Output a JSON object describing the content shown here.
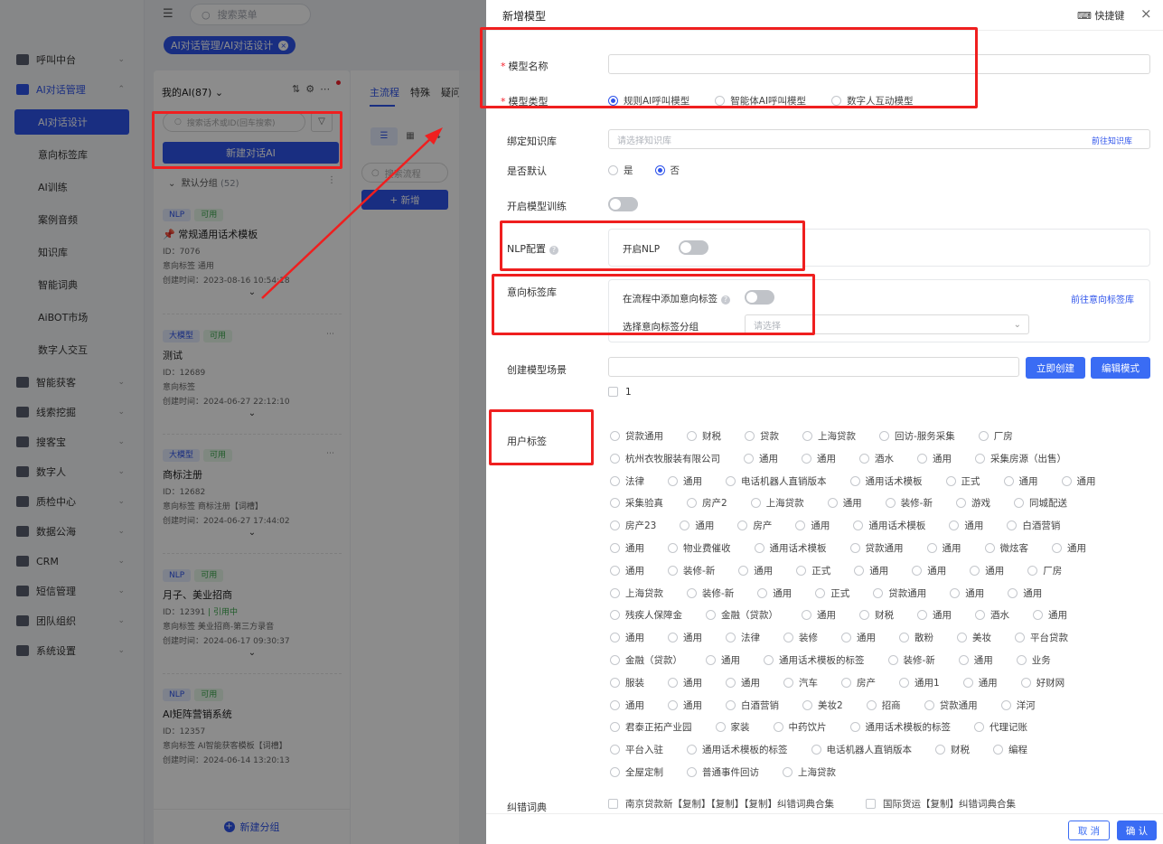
{
  "topbar": {
    "search_placeholder": "搜索菜单"
  },
  "breadcrumb": {
    "tag": "AI对话管理/AI对话设计"
  },
  "sidenav": {
    "items": [
      {
        "label": "呼叫中台"
      },
      {
        "label": "AI对话管理"
      },
      {
        "label": "智能获客"
      },
      {
        "label": "线索挖掘"
      },
      {
        "label": "搜客宝"
      },
      {
        "label": "数字人"
      },
      {
        "label": "质检中心"
      },
      {
        "label": "数据公海"
      },
      {
        "label": "CRM"
      },
      {
        "label": "短信管理"
      },
      {
        "label": "团队组织"
      },
      {
        "label": "系统设置"
      }
    ],
    "subitems": [
      {
        "label": "AI对话设计"
      },
      {
        "label": "意向标签库"
      },
      {
        "label": "AI训练"
      },
      {
        "label": "案例音频"
      },
      {
        "label": "知识库"
      },
      {
        "label": "智能词典"
      },
      {
        "label": "AiBOT市场"
      },
      {
        "label": "数字人交互"
      }
    ]
  },
  "list": {
    "header": "我的AI(87)",
    "search_placeholder": "搜索话术或ID(回车搜索)",
    "new_button": "新建对话AI",
    "group_label": "默认分组",
    "group_count": "(52)",
    "new_group": "新建分组",
    "cards": [
      {
        "tag1": "NLP",
        "tag2": "可用",
        "title": "常规通用话术模板",
        "id": "ID：7076",
        "intent": "意向标签    通用",
        "created": "创建时间：2023-08-16 10:54:18"
      },
      {
        "tag1": "大模型",
        "tag2": "可用",
        "title": "测试",
        "id": "ID：12689",
        "intent": "意向标签",
        "created": "创建时间：2024-06-27 22:12:10"
      },
      {
        "tag1": "大模型",
        "tag2": "可用",
        "title": "商标注册",
        "id": "ID：12682",
        "intent": "意向标签    商标注册【词槽】",
        "created": "创建时间：2024-06-27 17:44:02"
      },
      {
        "tag1": "NLP",
        "tag2": "可用",
        "title": "月子、美业招商",
        "id": "ID：12391",
        "ref": "引用中",
        "intent": "意向标签    美业招商-第三方录音",
        "created": "创建时间：2024-06-17 09:30:37"
      },
      {
        "tag1": "NLP",
        "tag2": "可用",
        "title": "AI矩阵营销系统",
        "id": "ID：12357",
        "intent": "意向标签    AI智能获客模板【词槽】",
        "created": "创建时间：2024-06-14 13:20:13"
      }
    ]
  },
  "middle": {
    "tabs": [
      "主流程",
      "特殊",
      "疑问"
    ],
    "search_placeholder": "搜索流程",
    "add_button": "+ 新增"
  },
  "drawer": {
    "title": "新增模型",
    "shortcut": "快捷键",
    "model_name_label": "模型名称",
    "model_type_label": "模型类型",
    "model_types": [
      "规则AI呼叫模型",
      "智能体AI呼叫模型",
      "数字人互动模型"
    ],
    "kb_label": "绑定知识库",
    "kb_placeholder": "请选择知识库",
    "kb_link": "前往知识库",
    "default_label": "是否默认",
    "default_options": [
      "是",
      "否"
    ],
    "train_label": "开启模型训练",
    "nlp_label": "NLP配置",
    "nlp_switch_label": "开启NLP",
    "intent_label": "意向标签库",
    "intent_add_label": "在流程中添加意向标签",
    "intent_link": "前往意向标签库",
    "intent_group_label": "选择意向标签分组",
    "intent_group_placeholder": "请选择",
    "scene_label": "创建模型场景",
    "create_now": "立即创建",
    "edit_mode": "编辑模式",
    "scene_option": "1",
    "user_tag_label": "用户标签",
    "user_tags": [
      [
        "贷款通用",
        "财税",
        "贷款",
        "上海贷款",
        "回访-服务采集",
        "厂房"
      ],
      [
        "杭州衣牧服装有限公司",
        "通用",
        "通用",
        "酒水",
        "通用",
        "采集房源（出售）"
      ],
      [
        "法律",
        "通用",
        "电话机器人直销版本",
        "通用话术模板",
        "正式",
        "通用",
        "通用"
      ],
      [
        "采集验真",
        "房产2",
        "上海贷款",
        "通用",
        "装修-新",
        "游戏",
        "同城配送"
      ],
      [
        "房产23",
        "通用",
        "房产",
        "通用",
        "通用话术模板",
        "通用",
        "白酒营销"
      ],
      [
        "通用",
        "物业费催收",
        "通用话术模板",
        "贷款通用",
        "通用",
        "微炫客",
        "通用"
      ],
      [
        "通用",
        "装修-新",
        "通用",
        "正式",
        "通用",
        "通用",
        "通用",
        "厂房"
      ],
      [
        "上海贷款",
        "装修-新",
        "通用",
        "正式",
        "贷款通用",
        "通用",
        "通用"
      ],
      [
        "残疾人保障金",
        "金融（贷款）",
        "通用",
        "财税",
        "通用",
        "酒水",
        "通用"
      ],
      [
        "通用",
        "通用",
        "法律",
        "装修",
        "通用",
        "散粉",
        "美妆",
        "平台贷款"
      ],
      [
        "金融（贷款）",
        "通用",
        "通用话术模板的标签",
        "装修-新",
        "通用",
        "业务"
      ],
      [
        "服装",
        "通用",
        "通用",
        "汽车",
        "房产",
        "通用1",
        "通用",
        "好财网"
      ],
      [
        "通用",
        "通用",
        "白酒营销",
        "美妆2",
        "招商",
        "贷款通用",
        "洋河"
      ],
      [
        "君泰正拓产业园",
        "家装",
        "中药饮片",
        "通用话术模板的标签",
        "代理记账"
      ],
      [
        "平台入驻",
        "通用话术模板的标签",
        "电话机器人直销版本",
        "财税",
        "编程"
      ],
      [
        "全屋定制",
        "普通事件回访",
        "上海贷款"
      ]
    ],
    "dict_label": "纠错词典",
    "dict_options": [
      "南京贷款新【复制】【复制】【复制】纠错词典合集",
      "国际货运【复制】纠错词典合集"
    ],
    "cancel": "取 消",
    "confirm": "确 认"
  }
}
